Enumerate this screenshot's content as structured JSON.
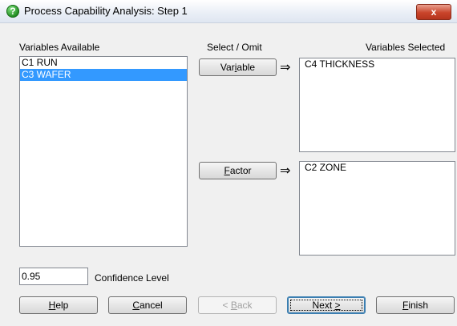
{
  "window": {
    "title": "Process Capability Analysis: Step 1",
    "close_glyph": "x"
  },
  "labels": {
    "variables_available": "Variables Available",
    "select_omit": "Select / Omit",
    "variables_selected": "Variables Selected",
    "confidence_level": "Confidence Level"
  },
  "available_list": [
    {
      "text": "C1 RUN",
      "selected": false
    },
    {
      "text": "C3 WAFER",
      "selected": true
    }
  ],
  "variable_box": [
    "C4 THICKNESS"
  ],
  "factor_box": [
    "C2 ZONE"
  ],
  "select_buttons": {
    "variable": {
      "pre": "Var",
      "mnemonic": "i",
      "post": "able"
    },
    "factor": {
      "pre": "",
      "mnemonic": "F",
      "post": "actor"
    }
  },
  "arrow_glyph": "⇒",
  "confidence_value": "0.95",
  "footer_buttons": {
    "help": {
      "pre": "",
      "mnemonic": "H",
      "post": "elp"
    },
    "cancel": {
      "pre": "",
      "mnemonic": "C",
      "post": "ancel"
    },
    "back": {
      "pre": "< ",
      "mnemonic": "B",
      "post": "ack",
      "enabled": false
    },
    "next": {
      "pre": "Next ",
      "mnemonic": ">",
      "post": "",
      "default": true
    },
    "finish": {
      "pre": "",
      "mnemonic": "F",
      "post": "inish"
    }
  }
}
